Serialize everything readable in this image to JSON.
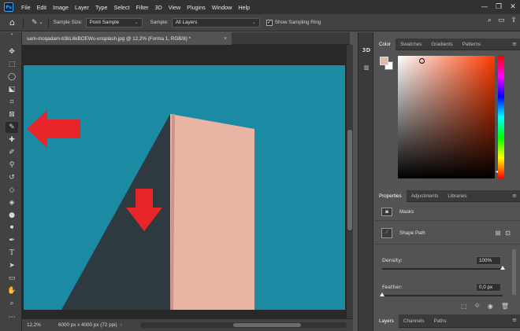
{
  "app": {
    "logo": "Ps"
  },
  "menubar": {
    "items": [
      "File",
      "Edit",
      "Image",
      "Layer",
      "Type",
      "Select",
      "Filter",
      "3D",
      "View",
      "Plugins",
      "Window",
      "Help"
    ]
  },
  "window_controls": {
    "minimize": "—",
    "restore": "❐",
    "close": "✕"
  },
  "options": {
    "sample_size_label": "Sample Size:",
    "sample_size_value": "Point Sample",
    "sample_label": "Sample:",
    "sample_value": "All Layers",
    "show_ring_label": "Show Sampling Ring",
    "show_ring_checked": "✓"
  },
  "document": {
    "tab_title": "sam-moqadam-b3kL6kBOEWs-unsplash.jpg @ 12,2% (Forma 1, RGB/8) *",
    "close_glyph": "×",
    "zoom": "12,2%",
    "dimensions": "6000 px x 4000 px (72 ppi)"
  },
  "image_colors": {
    "sky": "#1b8aa3",
    "wall": "#e8b4a4",
    "shadow": "#2f3a40",
    "arrow": "#e8262a"
  },
  "color_panel": {
    "tabs": [
      "Color",
      "Swatches",
      "Gradients",
      "Patterns"
    ],
    "foreground": "#e8b4a4",
    "background": "#ffffff"
  },
  "properties_panel": {
    "tabs": [
      "Properties",
      "Adjustments",
      "Libraries"
    ],
    "masks_label": "Masks",
    "shape_path_label": "Shape Path",
    "density_label": "Density:",
    "density_value": "100%",
    "density_level": 1.0,
    "feather_label": "Feather:",
    "feather_value": "0,0 px",
    "feather_level": 0.0
  },
  "layers_panel": {
    "tabs": [
      "Layers",
      "Channels",
      "Paths"
    ]
  }
}
